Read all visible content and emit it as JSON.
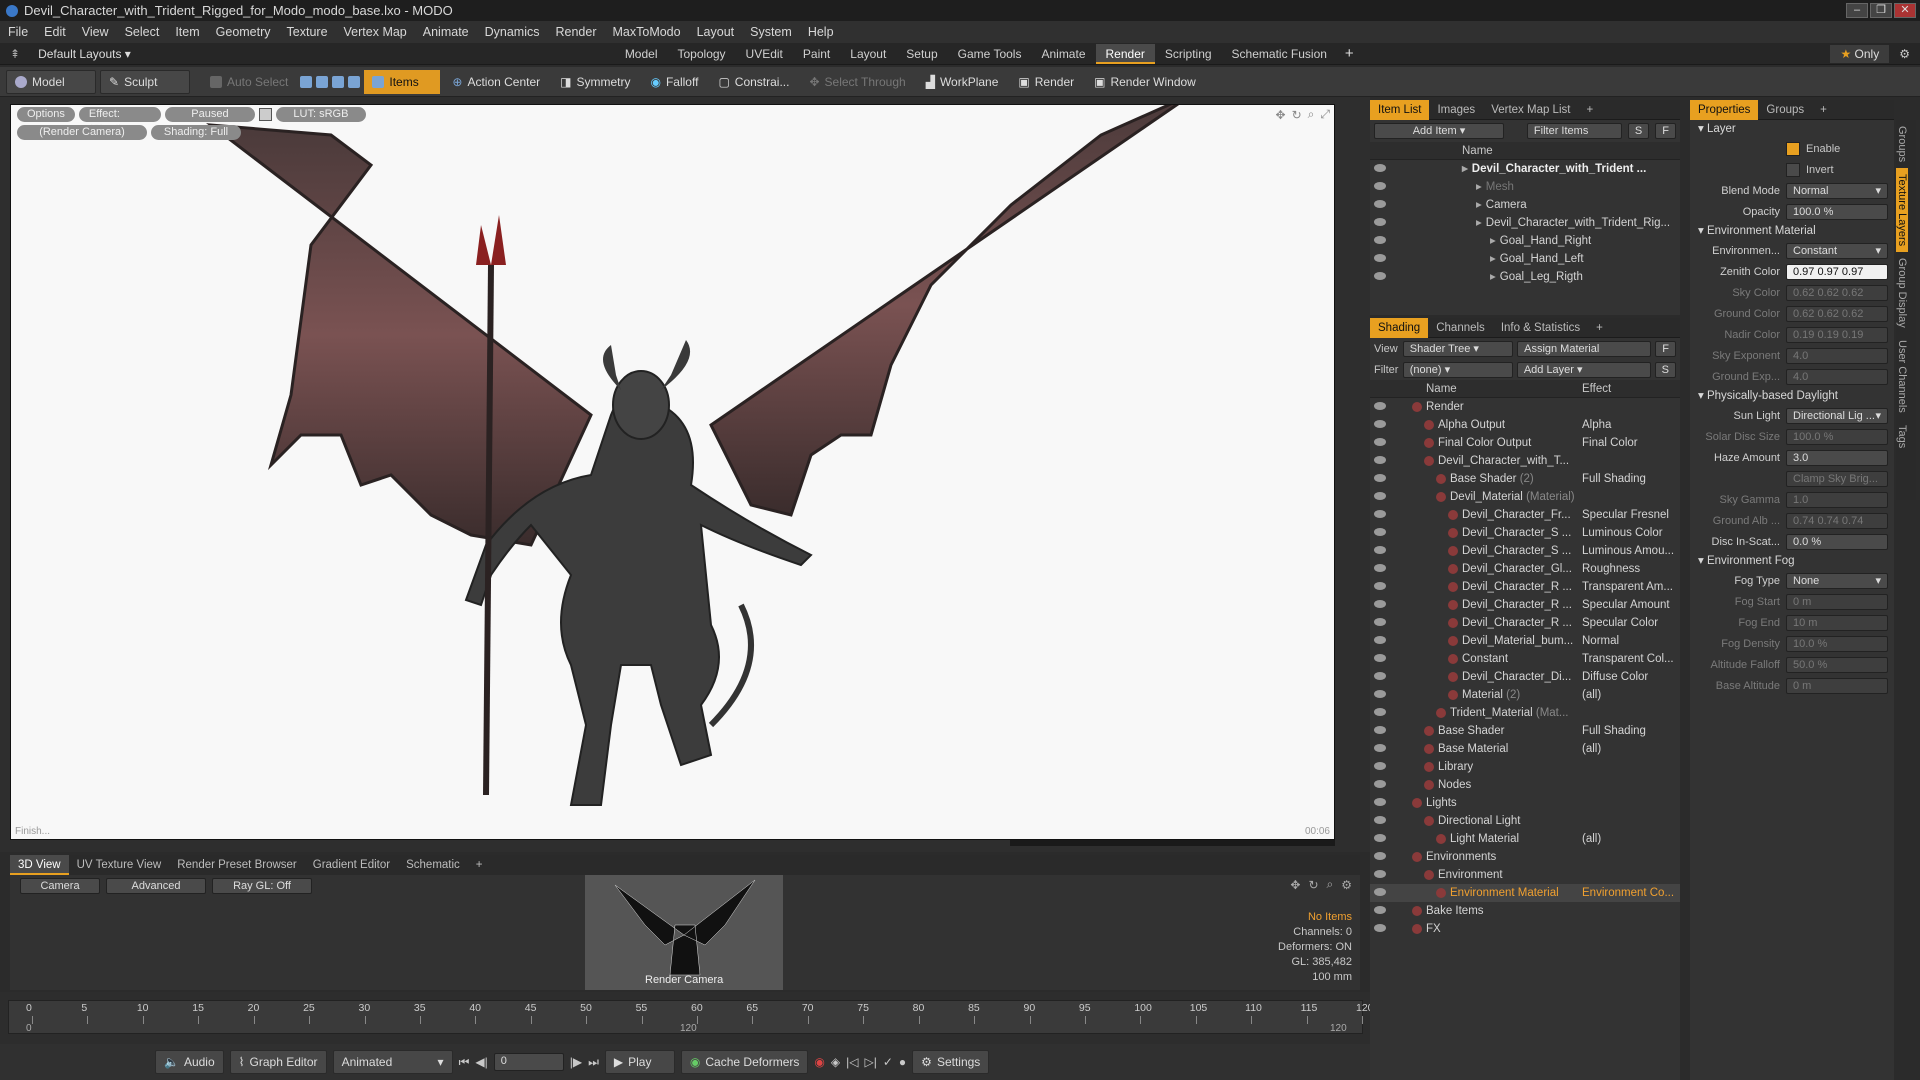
{
  "window": {
    "title": "Devil_Character_with_Trident_Rigged_for_Modo_modo_base.lxo - MODO"
  },
  "menu": [
    "File",
    "Edit",
    "View",
    "Select",
    "Item",
    "Geometry",
    "Texture",
    "Vertex Map",
    "Animate",
    "Dynamics",
    "Render",
    "MaxToModo",
    "Layout",
    "System",
    "Help"
  ],
  "layout": {
    "dropdown": "Default Layouts",
    "tabs": [
      "Model",
      "Topology",
      "UVEdit",
      "Paint",
      "Layout",
      "Setup",
      "Game Tools",
      "Animate",
      "Render",
      "Scripting",
      "Schematic Fusion"
    ],
    "active": "Render",
    "only": "Only"
  },
  "toolbar": {
    "model": "Model",
    "sculpt": "Sculpt",
    "auto_select": "Auto Select",
    "items": "Items",
    "action_center": "Action Center",
    "symmetry": "Symmetry",
    "falloff": "Falloff",
    "constrain": "Constrai...",
    "select_through": "Select Through",
    "workplane": "WorkPlane",
    "render": "Render",
    "render_window": "Render Window"
  },
  "viewport": {
    "options": "Options",
    "effect": "Effect: (Shadi...",
    "paused": "Paused",
    "lut": "LUT: sRGB",
    "camera": "(Render Camera)",
    "shading": "Shading: Full",
    "status": "Finish...",
    "time": "00:06"
  },
  "bottom_tabs": [
    "3D View",
    "UV Texture View",
    "Render Preset Browser",
    "Gradient Editor",
    "Schematic"
  ],
  "bottom_panel": {
    "camera": "Camera",
    "advanced": "Advanced",
    "raygl": "Ray GL: Off",
    "thumb_label": "Render Camera",
    "info": {
      "no_items": "No Items",
      "channels": "Channels: 0",
      "deformers": "Deformers: ON",
      "gl": "GL: 385,482",
      "size": "100 mm"
    }
  },
  "timeline": {
    "ticks": [
      0,
      5,
      10,
      15,
      20,
      25,
      30,
      35,
      40,
      45,
      50,
      55,
      60,
      65,
      70,
      75,
      80,
      85,
      90,
      95,
      100,
      105,
      110,
      115,
      120
    ],
    "start": "0",
    "end": "120",
    "mid": "120"
  },
  "transport": {
    "audio": "Audio",
    "graph_editor": "Graph Editor",
    "animated": "Animated",
    "frame": "0",
    "play": "Play",
    "cache": "Cache Deformers",
    "settings": "Settings"
  },
  "item_list": {
    "tabs": [
      "Item List",
      "Images",
      "Vertex Map List"
    ],
    "add_item": "Add Item",
    "filter": "Filter Items",
    "col_name": "Name",
    "rows": [
      {
        "indent": 0,
        "label": "Devil_Character_with_Trident ...",
        "bold": true
      },
      {
        "indent": 1,
        "label": "Mesh",
        "dim": true
      },
      {
        "indent": 1,
        "label": "Camera"
      },
      {
        "indent": 1,
        "label": "Devil_Character_with_Trident_Rig..."
      },
      {
        "indent": 2,
        "label": "Goal_Hand_Right"
      },
      {
        "indent": 2,
        "label": "Goal_Hand_Left"
      },
      {
        "indent": 2,
        "label": "Goal_Leg_Rigth"
      }
    ]
  },
  "shading": {
    "tabs": [
      "Shading",
      "Channels",
      "Info & Statistics"
    ],
    "view_label": "View",
    "view_value": "Shader Tree",
    "assign": "Assign Material",
    "filter_label": "Filter",
    "filter_value": "(none)",
    "add_layer": "Add Layer",
    "col_name": "Name",
    "col_effect": "Effect",
    "rows": [
      {
        "i": 0,
        "name": "Render",
        "effect": ""
      },
      {
        "i": 1,
        "name": "Alpha Output",
        "effect": "Alpha"
      },
      {
        "i": 1,
        "name": "Final Color Output",
        "effect": "Final Color"
      },
      {
        "i": 1,
        "name": "Devil_Character_with_T...",
        "effect": ""
      },
      {
        "i": 2,
        "name": "Base Shader",
        "extra": "(2)",
        "effect": "Full Shading"
      },
      {
        "i": 2,
        "name": "Devil_Material",
        "extra": "(Material)",
        "effect": ""
      },
      {
        "i": 3,
        "name": "Devil_Character_Fr...",
        "effect": "Specular Fresnel"
      },
      {
        "i": 3,
        "name": "Devil_Character_S ...",
        "effect": "Luminous Color"
      },
      {
        "i": 3,
        "name": "Devil_Character_S ...",
        "effect": "Luminous Amou..."
      },
      {
        "i": 3,
        "name": "Devil_Character_Gl...",
        "effect": "Roughness"
      },
      {
        "i": 3,
        "name": "Devil_Character_R ...",
        "effect": "Transparent Am..."
      },
      {
        "i": 3,
        "name": "Devil_Character_R ...",
        "effect": "Specular Amount"
      },
      {
        "i": 3,
        "name": "Devil_Character_R ...",
        "effect": "Specular Color"
      },
      {
        "i": 3,
        "name": "Devil_Material_bum...",
        "effect": "Normal"
      },
      {
        "i": 3,
        "name": "Constant",
        "effect": "Transparent Col..."
      },
      {
        "i": 3,
        "name": "Devil_Character_Di...",
        "effect": "Diffuse Color"
      },
      {
        "i": 3,
        "name": "Material",
        "extra": "(2)",
        "effect": "(all)"
      },
      {
        "i": 2,
        "name": "Trident_Material",
        "extra": "(Mat...",
        "effect": ""
      },
      {
        "i": 1,
        "name": "Base Shader",
        "effect": "Full Shading"
      },
      {
        "i": 1,
        "name": "Base Material",
        "effect": "(all)"
      },
      {
        "i": 1,
        "name": "Library",
        "effect": ""
      },
      {
        "i": 1,
        "name": "Nodes",
        "effect": ""
      },
      {
        "i": 0,
        "name": "Lights",
        "effect": ""
      },
      {
        "i": 1,
        "name": "Directional Light",
        "effect": ""
      },
      {
        "i": 2,
        "name": "Light Material",
        "effect": "(all)"
      },
      {
        "i": 0,
        "name": "Environments",
        "effect": ""
      },
      {
        "i": 1,
        "name": "Environment",
        "effect": ""
      },
      {
        "i": 2,
        "name": "Environment Material",
        "effect": "Environment Co...",
        "selected": true
      },
      {
        "i": 0,
        "name": "Bake Items",
        "effect": ""
      },
      {
        "i": 0,
        "name": "FX",
        "effect": ""
      }
    ]
  },
  "properties": {
    "tabs": [
      "Properties",
      "Groups"
    ],
    "layer_head": "Layer",
    "enable": "Enable",
    "invert": "Invert",
    "rows": [
      {
        "label": "Blend Mode",
        "value": "Normal",
        "dd": true
      },
      {
        "label": "Opacity",
        "value": "100.0 %"
      }
    ],
    "env_head": "Environment Material",
    "env_rows": [
      {
        "label": "Environmen...",
        "value": "Constant",
        "dd": true
      },
      {
        "label": "Zenith Color",
        "value": "0.97 0.97 0.97",
        "white": true
      },
      {
        "label": "Sky Color",
        "value": "0.62 0.62 0.62",
        "dim": true
      },
      {
        "label": "Ground Color",
        "value": "0.62 0.62 0.62",
        "dim": true
      },
      {
        "label": "Nadir Color",
        "value": "0.19 0.19 0.19",
        "dim": true
      },
      {
        "label": "Sky Exponent",
        "value": "4.0",
        "dim": true
      },
      {
        "label": "Ground Exp...",
        "value": "4.0",
        "dim": true
      }
    ],
    "daylight_head": "Physically-based Daylight",
    "daylight_rows": [
      {
        "label": "Sun Light",
        "value": "Directional Lig ...",
        "dd": true
      },
      {
        "label": "Solar Disc Size",
        "value": "100.0 %",
        "dim": true
      },
      {
        "label": "Haze Amount",
        "value": "3.0"
      },
      {
        "label": "",
        "value": "Clamp Sky Brig...",
        "dim": true,
        "check": true
      },
      {
        "label": "Sky Gamma",
        "value": "1.0",
        "dim": true
      },
      {
        "label": "Ground Alb ...",
        "value": "0.74 0.74 0.74",
        "dim": true
      },
      {
        "label": "Disc In-Scat...",
        "value": "0.0 %"
      }
    ],
    "fog_head": "Environment Fog",
    "fog_rows": [
      {
        "label": "Fog Type",
        "value": "None",
        "dd": true
      },
      {
        "label": "Fog Start",
        "value": "0 m",
        "dim": true
      },
      {
        "label": "Fog End",
        "value": "10 m",
        "dim": true
      },
      {
        "label": "Fog Density",
        "value": "10.0 %",
        "dim": true
      },
      {
        "label": "Altitude Falloff",
        "value": "50.0 %",
        "dim": true
      },
      {
        "label": "Base Altitude",
        "value": "0 m",
        "dim": true
      }
    ]
  },
  "side_tabs": [
    "Groups",
    "Texture Layers",
    "Group Display",
    "User Channels",
    "Tags"
  ],
  "colors": {
    "accent": "#e8a020",
    "selected_text": "#f0a030"
  }
}
